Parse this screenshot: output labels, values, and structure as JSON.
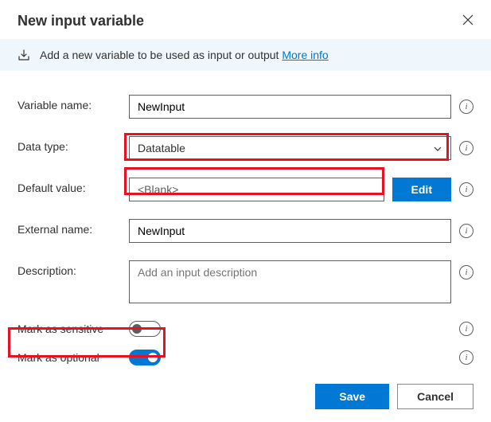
{
  "dialog": {
    "title": "New input variable",
    "banner_text": "Add a new variable to be used as input or output",
    "more_info_label": "More info"
  },
  "labels": {
    "variable_name": "Variable name:",
    "data_type": "Data type:",
    "default_value": "Default value:",
    "external_name": "External name:",
    "description": "Description:",
    "mark_sensitive": "Mark as sensitive",
    "mark_optional": "Mark as optional"
  },
  "fields": {
    "variable_name": "NewInput",
    "data_type": "Datatable",
    "default_value": "<Blank>",
    "external_name": "NewInput",
    "description": "",
    "description_placeholder": "Add an input description",
    "mark_sensitive_on": false,
    "mark_optional_on": true
  },
  "buttons": {
    "edit": "Edit",
    "save": "Save",
    "cancel": "Cancel"
  }
}
